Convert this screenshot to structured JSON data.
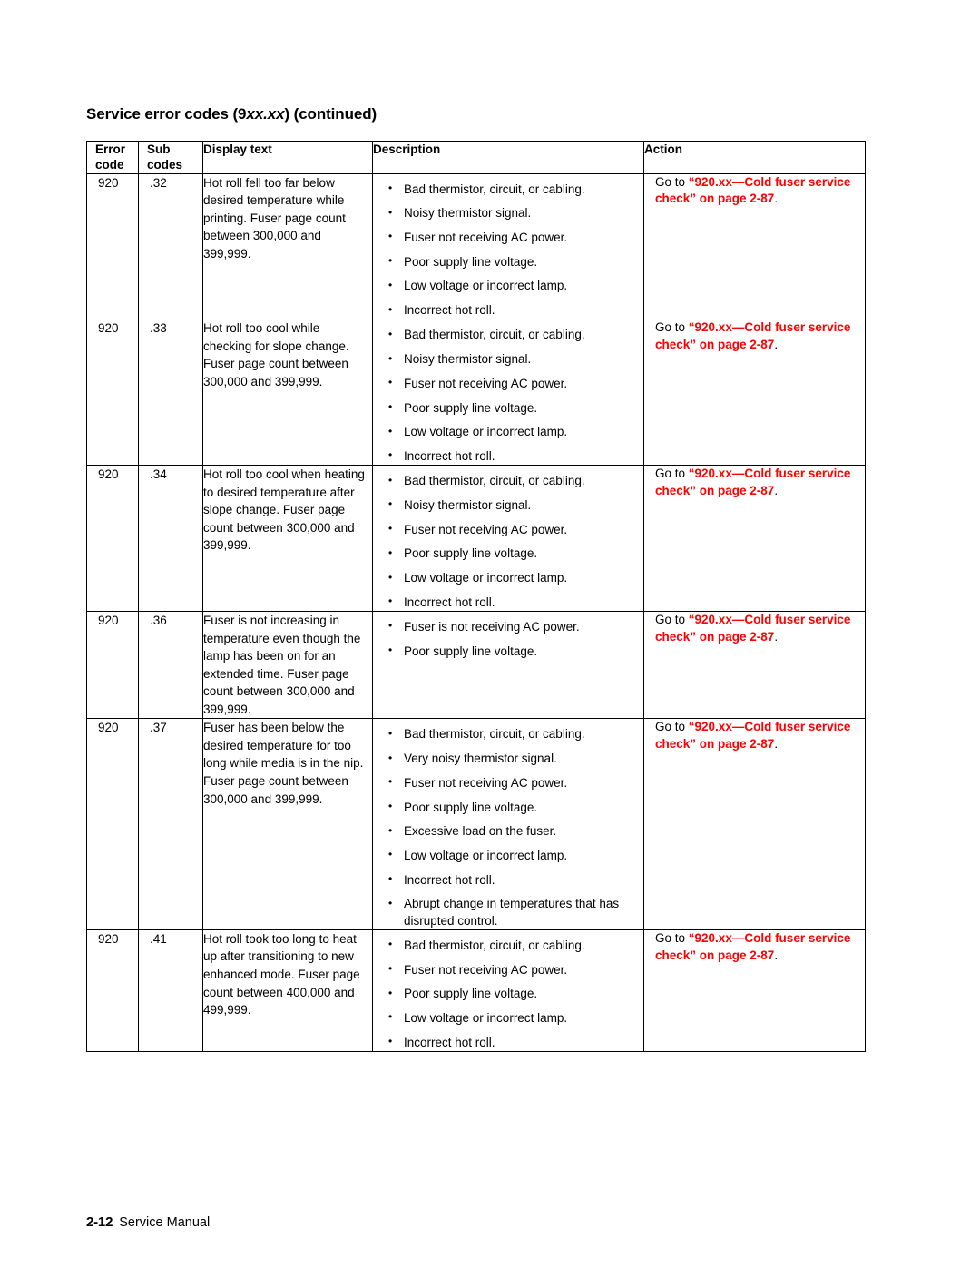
{
  "page": {
    "heading_prefix": "Service error codes (9",
    "heading_italic": "xx.xx",
    "heading_suffix": ") (continued)",
    "heading_full": "Service error codes (9xx.xx) (continued)",
    "accent_red": "#FF0000",
    "text_color": "#000000",
    "background": "#FFFFFF"
  },
  "table": {
    "headers": {
      "error_code": "Error code",
      "error_code_line1": "Error",
      "error_code_line2": "code",
      "sub_codes": "Sub codes",
      "sub_codes_line1": "Sub",
      "sub_codes_line2": "codes",
      "display_text": "Display text",
      "description": "Description",
      "action": "Action"
    },
    "rows": [
      {
        "error_code": "920",
        "sub_code": ".32",
        "display_text": "Hot roll fell too far below desired temperature while printing. Fuser page count between 300,000 and 399,999.",
        "description": [
          "Bad thermistor, circuit, or cabling.",
          "Noisy thermistor signal.",
          "Fuser not receiving AC power.",
          "Poor supply line voltage.",
          "Low voltage or incorrect lamp.",
          "Incorrect hot roll."
        ],
        "action": {
          "lead": "Go to ",
          "link": "“920.xx—Cold fuser service check” on page 2-87",
          "tail": "."
        }
      },
      {
        "error_code": "920",
        "sub_code": ".33",
        "display_text": "Hot roll too cool while checking for slope change. Fuser page count between 300,000 and 399,999.",
        "description": [
          "Bad thermistor, circuit, or cabling.",
          "Noisy thermistor signal.",
          "Fuser not receiving AC power.",
          "Poor supply line voltage.",
          "Low voltage or incorrect lamp.",
          "Incorrect hot roll."
        ],
        "action": {
          "lead": "Go to ",
          "link": "“920.xx—Cold fuser service check” on page 2-87",
          "tail": "."
        }
      },
      {
        "error_code": "920",
        "sub_code": ".34",
        "display_text": "Hot roll too cool when heating to desired temperature after slope change. Fuser page count between 300,000 and 399,999.",
        "description": [
          "Bad thermistor, circuit, or cabling.",
          "Noisy thermistor signal.",
          "Fuser not receiving AC power.",
          "Poor supply line voltage.",
          "Low voltage or incorrect lamp.",
          "Incorrect hot roll."
        ],
        "action": {
          "lead": "Go to ",
          "link": "“920.xx—Cold fuser service check” on page 2-87",
          "tail": "."
        }
      },
      {
        "error_code": "920",
        "sub_code": ".36",
        "display_text": "Fuser is not increasing in temperature even though the lamp has been on for an extended time. Fuser page count between 300,000 and 399,999.",
        "description": [
          "Fuser is not receiving AC power.",
          "Poor supply line voltage."
        ],
        "action": {
          "lead": "Go to ",
          "link": "“920.xx—Cold fuser service check” on page 2-87",
          "tail": "."
        }
      },
      {
        "error_code": "920",
        "sub_code": ".37",
        "display_text": "Fuser has been below the desired temperature for too long while media is in the nip. Fuser page count between 300,000 and 399,999.",
        "description": [
          "Bad thermistor, circuit, or cabling.",
          "Very noisy thermistor signal.",
          "Fuser not receiving AC power.",
          "Poor supply line voltage.",
          "Excessive load on the fuser.",
          "Low voltage or incorrect lamp.",
          "Incorrect hot roll.",
          "Abrupt change in temperatures that has disrupted control."
        ],
        "action": {
          "lead": "Go to ",
          "link": "“920.xx—Cold fuser service check” on page 2-87",
          "tail": "."
        }
      },
      {
        "error_code": "920",
        "sub_code": ".41",
        "display_text": "Hot roll took too long to heat up after transitioning to new enhanced mode. Fuser page count between 400,000 and 499,999.",
        "description": [
          "Bad thermistor, circuit, or cabling.",
          "Fuser not receiving AC power.",
          "Poor supply line voltage.",
          "Low voltage or incorrect lamp.",
          "Incorrect hot roll."
        ],
        "action": {
          "lead": "Go to ",
          "link": "“920.xx—Cold fuser service check” on page 2-87",
          "tail": "."
        }
      }
    ]
  },
  "footer": {
    "page_number": "2-12",
    "label": "Service Manual"
  }
}
